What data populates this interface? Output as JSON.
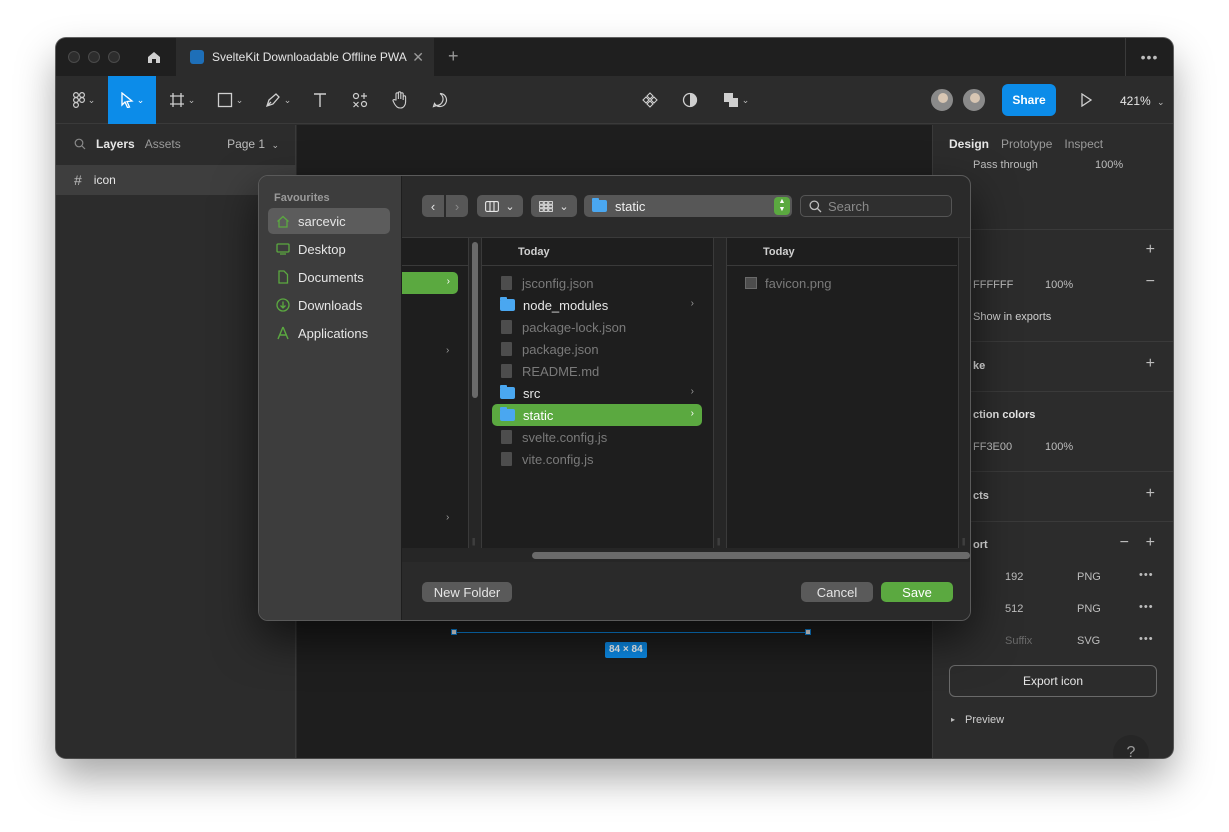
{
  "titlebar": {
    "tab_title": "SvelteKit Downloadable Offline PWA",
    "close_glyph": "✕",
    "plus_glyph": "+",
    "more_glyph": "•••"
  },
  "toolbar": {
    "share_label": "Share",
    "zoom_level": "421%"
  },
  "left_panel": {
    "tabs": [
      "Layers",
      "Assets"
    ],
    "page_label": "Page 1",
    "layers": [
      {
        "name": "icon"
      }
    ]
  },
  "canvas": {
    "dimension_badge": "84 × 84"
  },
  "right_panel": {
    "tabs": [
      "Design",
      "Prototype",
      "Inspect"
    ],
    "blend_mode": "Pass through",
    "layer_opacity": "100%",
    "fill_hex": "FFFFFF",
    "fill_opacity": "100%",
    "show_in_exports": "Show in exports",
    "stroke_label": "ke",
    "selection_colors_label": "ction colors",
    "selection_color_hex": "FF3E00",
    "selection_color_opacity": "100%",
    "effects_label": "cts",
    "export_label": "ort",
    "exports": [
      {
        "scale": "192",
        "format": "PNG"
      },
      {
        "scale": "512",
        "format": "PNG"
      },
      {
        "scale": "Suffix",
        "format": "SVG"
      }
    ],
    "export_button": "Export icon",
    "preview_label": "Preview",
    "help_glyph": "?"
  },
  "dialog": {
    "favourites_label": "Favourites",
    "favourites": [
      {
        "label": "sarcevic",
        "icon": "home-icon"
      },
      {
        "label": "Desktop",
        "icon": "desktop-icon"
      },
      {
        "label": "Documents",
        "icon": "document-icon"
      },
      {
        "label": "Downloads",
        "icon": "download-icon"
      },
      {
        "label": "Applications",
        "icon": "applications-icon"
      }
    ],
    "current_folder": "static",
    "search_placeholder": "Search",
    "columns": [
      {
        "header": "Today",
        "items": [
          {
            "name": "jsconfig.json",
            "kind": "file"
          },
          {
            "name": "node_modules",
            "kind": "folder"
          },
          {
            "name": "package-lock.json",
            "kind": "file"
          },
          {
            "name": "package.json",
            "kind": "file"
          },
          {
            "name": "README.md",
            "kind": "file"
          },
          {
            "name": "src",
            "kind": "folder"
          },
          {
            "name": "static",
            "kind": "folder",
            "selected": true
          },
          {
            "name": "svelte.config.js",
            "kind": "file"
          },
          {
            "name": "vite.config.js",
            "kind": "file"
          }
        ]
      },
      {
        "header": "Today",
        "items": [
          {
            "name": "favicon.png",
            "kind": "image"
          }
        ]
      }
    ],
    "new_folder_label": "New Folder",
    "cancel_label": "Cancel",
    "save_label": "Save",
    "accent_color": "#5ba940"
  }
}
